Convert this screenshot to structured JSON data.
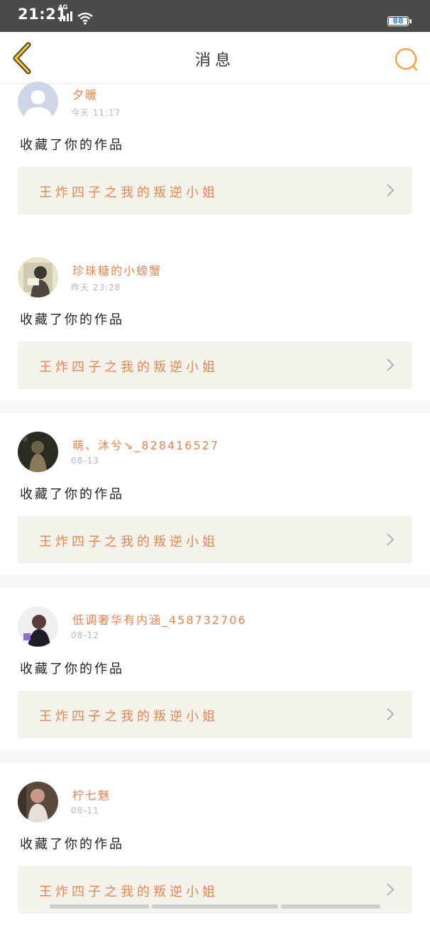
{
  "status_bar": {
    "time": "21:21",
    "network": "4G",
    "battery": "88"
  },
  "header": {
    "title": "消息"
  },
  "colors": {
    "accent": "#e8864f",
    "back_icon": "#f0c419",
    "search_icon": "#f5a24b",
    "work_bg": "#f3f3ec"
  },
  "messages": [
    {
      "username": "夕暖",
      "time": "今天 11:17",
      "action": "收藏了你的作品",
      "work_title": "王炸四子之我的叛逆小姐"
    },
    {
      "username": "珍珠糖的小螃蟹",
      "time": "昨天 23:28",
      "action": "收藏了你的作品",
      "work_title": "王炸四子之我的叛逆小姐"
    },
    {
      "username": "萌、沐兮↘_828416527",
      "time": "08-13",
      "action": "收藏了你的作品",
      "work_title": "王炸四子之我的叛逆小姐"
    },
    {
      "username": "低调奢华有内涵_458732706",
      "time": "08-12",
      "action": "收藏了你的作品",
      "work_title": "王炸四子之我的叛逆小姐"
    },
    {
      "username": "柠七魅",
      "time": "08-11",
      "action": "收藏了你的作品",
      "work_title": "王炸四子之我的叛逆小姐"
    }
  ]
}
